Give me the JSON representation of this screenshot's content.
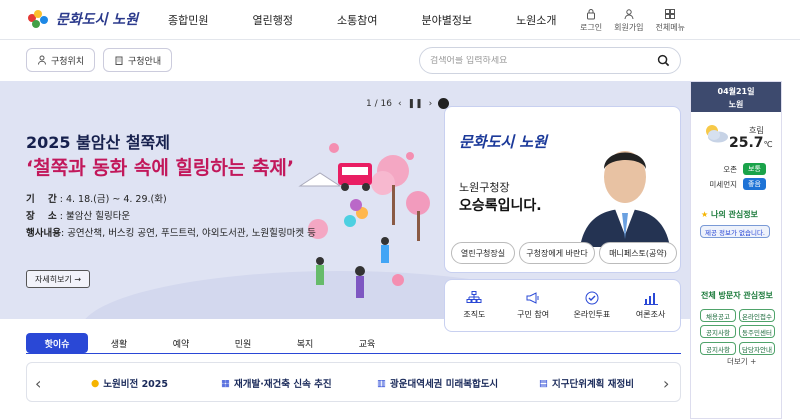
{
  "header": {
    "logo_text": "문화도시 노원",
    "nav": [
      "종합민원",
      "열린행정",
      "소통참여",
      "분야별정보",
      "노원소개"
    ],
    "util": [
      "로그인",
      "회원가입",
      "전체메뉴"
    ]
  },
  "subbar": {
    "btn_location": "구청위치",
    "btn_guide": "구청안내",
    "search_placeholder": "검색어를 입력하세요"
  },
  "hero": {
    "pager": "1 / 16",
    "title": "2025 불암산 철쭉제",
    "subtitle": "‘철쭉과 동화 속에 힐링하는 축제’",
    "period_label": "기    간",
    "period_value": ": 4. 18.(금) ~ 4. 29.(화)",
    "place_label": "장    소",
    "place_value": ": 불암산 힐링타운",
    "events_label": "행사내용",
    "events_value": ": 공연산책, 버스킹 공연, 푸드트럭, 야외도서관, 노원힐링마켓 등",
    "more": "자세히보기 →"
  },
  "mayor": {
    "logo": "문화도시 노원",
    "line1": "노원구청장",
    "line2": "오승록입니다.",
    "btn1": "열린구청장실",
    "btn2": "구청장에게 바란다",
    "btn3": "매니페스토(공약)"
  },
  "quick": [
    "조직도",
    "구민 참여",
    "온라인투표",
    "여론조사"
  ],
  "panel": {
    "date": "04월21일",
    "region": "노원",
    "condition": "흐림",
    "temp": "25.7",
    "temp_unit": "℃",
    "pm10_label": "오존",
    "pm10_value": "보통",
    "pm25_label": "미세먼지",
    "pm25_value": "좋음",
    "interest_title": "나의 관심정보",
    "interest_empty": "제공 정보가 없습니다.",
    "visitor_title": "전체 방문자 관심정보",
    "tags": [
      "채용공고",
      "온라인접수",
      "공지사항",
      "동주민센터",
      "공지사항",
      "담당자안내"
    ],
    "more": "더보기 +"
  },
  "tabs": [
    "핫이슈",
    "생활",
    "예약",
    "민원",
    "복지",
    "교육"
  ],
  "issues": [
    "노원비전 2025",
    "재개발·재건축 신속 추진",
    "광운대역세권 미래복합도시",
    "지구단위계획 재정비"
  ],
  "colors": {
    "primary": "#2a48d6",
    "hero_bg": "#dfe3f3",
    "accent": "#c2185b",
    "green": "#1aa34a"
  }
}
